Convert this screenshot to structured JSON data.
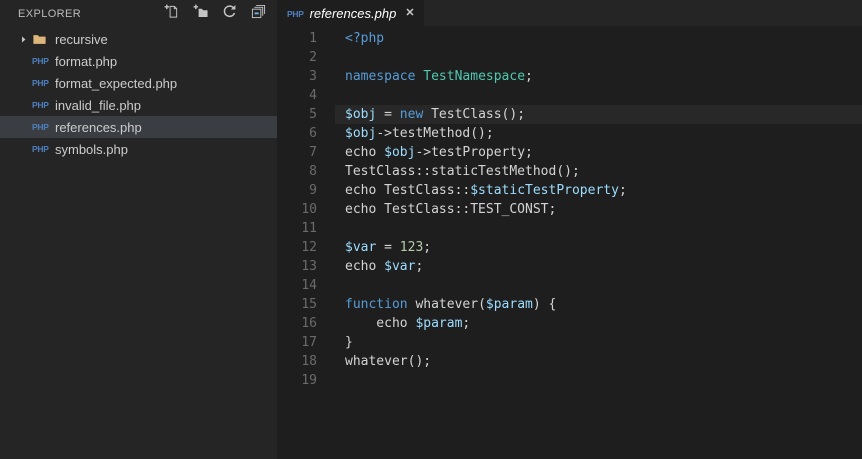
{
  "colors": {
    "editor_bg": "#1e1e1e",
    "sidebar_bg": "#252526",
    "tab_bar_bg": "#252526",
    "active_tab_bg": "#1e1e1e",
    "selected_item_bg": "#3a3d41",
    "current_line_bg": "#282828",
    "keyword": "#569cd6",
    "type": "#4ec9b0",
    "variable": "#9cdcfe",
    "number": "#b5cea8",
    "text": "#d4d4d4",
    "line_number": "#6b6b6b",
    "sidebar_text": "#cccccc",
    "explorer_title": "#bbbbbb",
    "icon_color": "#c5c5c5",
    "php_icon_color": "#4d7fbe",
    "folder_icon_color": "#dcb67a",
    "tab_text": "#ffffff",
    "collapse_minus": "#6fb3e0"
  },
  "sidebar": {
    "title": "EXPLORER",
    "php_badge_text": "PHP",
    "toolbar": [
      {
        "name": "new-file",
        "icon": "new-file-icon"
      },
      {
        "name": "new-folder",
        "icon": "new-folder-icon"
      },
      {
        "name": "refresh",
        "icon": "refresh-icon"
      },
      {
        "name": "collapse-all",
        "icon": "collapse-all-icon"
      }
    ],
    "items": [
      {
        "label": "recursive",
        "type": "folder",
        "expanded": false,
        "selected": false
      },
      {
        "label": "format.php",
        "type": "php",
        "selected": false
      },
      {
        "label": "format_expected.php",
        "type": "php",
        "selected": false
      },
      {
        "label": "invalid_file.php",
        "type": "php",
        "selected": false
      },
      {
        "label": "references.php",
        "type": "php",
        "selected": true
      },
      {
        "label": "symbols.php",
        "type": "php",
        "selected": false
      }
    ]
  },
  "editor": {
    "tabs": [
      {
        "label": "references.php",
        "icon": "php-file-icon",
        "close_glyph": "✕",
        "active": true,
        "preview_italic": true
      }
    ],
    "active_line": 5,
    "token_classes": {
      "k": "tok-keyword",
      "t": "tok-type",
      "v": "tok-variable",
      "n": "tok-number"
    },
    "lines": [
      [
        {
          "t": "<?php",
          "c": "k"
        }
      ],
      [],
      [
        {
          "t": "namespace",
          "c": "k"
        },
        {
          "t": " "
        },
        {
          "t": "TestNamespace",
          "c": "t"
        },
        {
          "t": ";"
        }
      ],
      [],
      [
        {
          "t": "$obj",
          "c": "v"
        },
        {
          "t": " = "
        },
        {
          "t": "new",
          "c": "k"
        },
        {
          "t": " TestClass();"
        }
      ],
      [
        {
          "t": "$obj",
          "c": "v"
        },
        {
          "t": "->testMethod();"
        }
      ],
      [
        {
          "t": "echo "
        },
        {
          "t": "$obj",
          "c": "v"
        },
        {
          "t": "->testProperty;"
        }
      ],
      [
        {
          "t": "TestClass::staticTestMethod();"
        }
      ],
      [
        {
          "t": "echo TestClass::"
        },
        {
          "t": "$staticTestProperty",
          "c": "v"
        },
        {
          "t": ";"
        }
      ],
      [
        {
          "t": "echo TestClass::TEST_CONST;"
        }
      ],
      [],
      [
        {
          "t": "$var",
          "c": "v"
        },
        {
          "t": " = "
        },
        {
          "t": "123",
          "c": "n"
        },
        {
          "t": ";"
        }
      ],
      [
        {
          "t": "echo "
        },
        {
          "t": "$var",
          "c": "v"
        },
        {
          "t": ";"
        }
      ],
      [],
      [
        {
          "t": "function",
          "c": "k"
        },
        {
          "t": " whatever("
        },
        {
          "t": "$param",
          "c": "v"
        },
        {
          "t": ") {"
        }
      ],
      [
        {
          "t": "    echo "
        },
        {
          "t": "$param",
          "c": "v"
        },
        {
          "t": ";"
        }
      ],
      [
        {
          "t": "}"
        }
      ],
      [
        {
          "t": "whatever();"
        }
      ],
      []
    ]
  }
}
